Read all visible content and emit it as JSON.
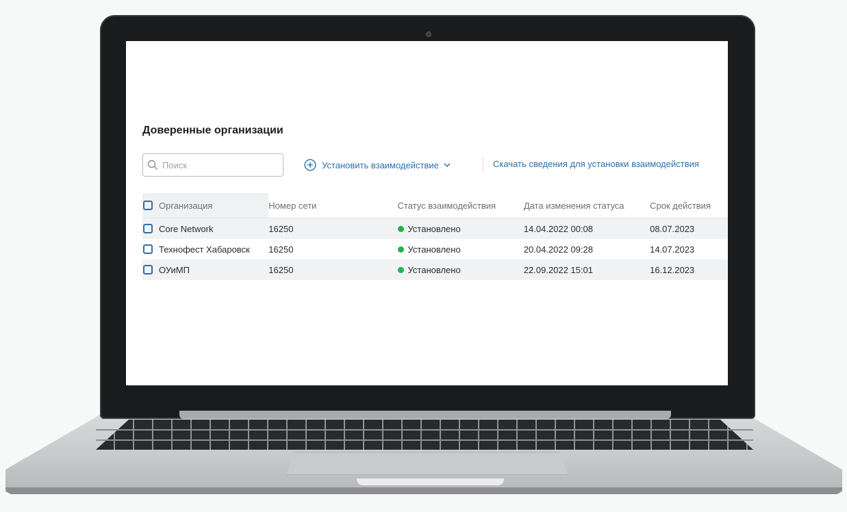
{
  "app": {
    "title": "Доверенные организации",
    "search": {
      "placeholder": "Поиск",
      "value": ""
    },
    "actions": {
      "establish_label": "Установить взаимодействие",
      "download_label": "Скачать сведения для установки взаимодействия"
    },
    "table": {
      "headers": {
        "org": "Организация",
        "network": "Номер сети",
        "status": "Статус взаимодействия",
        "changed": "Дата изменения статуса",
        "expires": "Срок действия"
      },
      "rows": [
        {
          "org": "Core Network",
          "network": "16250",
          "status": "Установлено",
          "changed": "14.04.2022 00:08",
          "expires": "08.07.2023"
        },
        {
          "org": "Технофест Хабаровск",
          "network": "16250",
          "status": "Установлено",
          "changed": "20.04.2022 09:28",
          "expires": "14.07.2023"
        },
        {
          "org": "ОУиМП",
          "network": "16250",
          "status": "Установлено",
          "changed": "22.09.2022 15:01",
          "expires": "16.12.2023"
        }
      ]
    }
  },
  "icons": {
    "search": "search-icon",
    "add": "plus-circle-icon",
    "chevron": "chevron-down-icon",
    "status": "status-dot-icon"
  },
  "colors": {
    "accent": "#2e6fa8",
    "status_ok": "#22b14c",
    "row_alt": "#f1f2f3"
  }
}
